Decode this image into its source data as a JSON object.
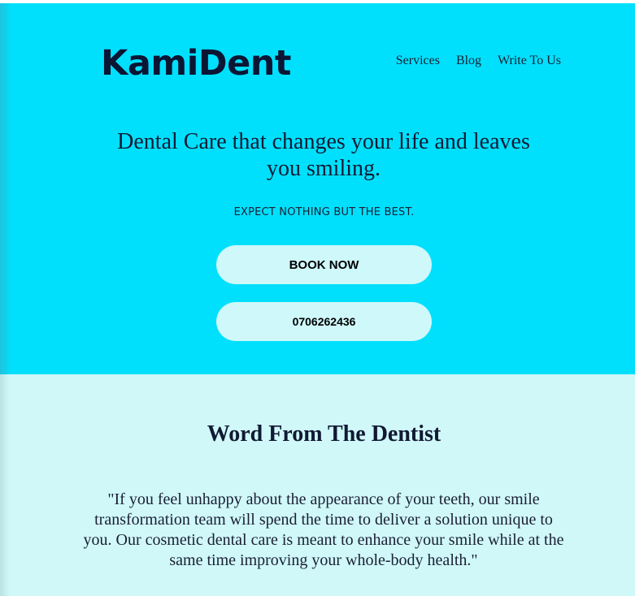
{
  "header": {
    "logo": "KamiDent",
    "nav": [
      "Services",
      "Blog",
      "Write To Us"
    ]
  },
  "hero": {
    "tagline": "Dental Care that changes your life and leaves you smiling.",
    "subtagline": "EXPECT NOTHING BUT THE BEST.",
    "book_label": "BOOK NOW",
    "phone_label": "0706262436"
  },
  "dentist_section": {
    "heading": "Word From The Dentist",
    "quote": "\"If you feel unhappy about the appearance of your teeth, our smile transformation team will spend the time to deliver a solution unique to you. Our cosmetic dental care is meant to enhance your smile while at the same time improving your whole-body health.\""
  },
  "colors": {
    "hero_bg": "#00e0fd",
    "section_bg": "#d0f8f9",
    "button_bg": "#cff8fb",
    "text_dark": "#111a33"
  }
}
